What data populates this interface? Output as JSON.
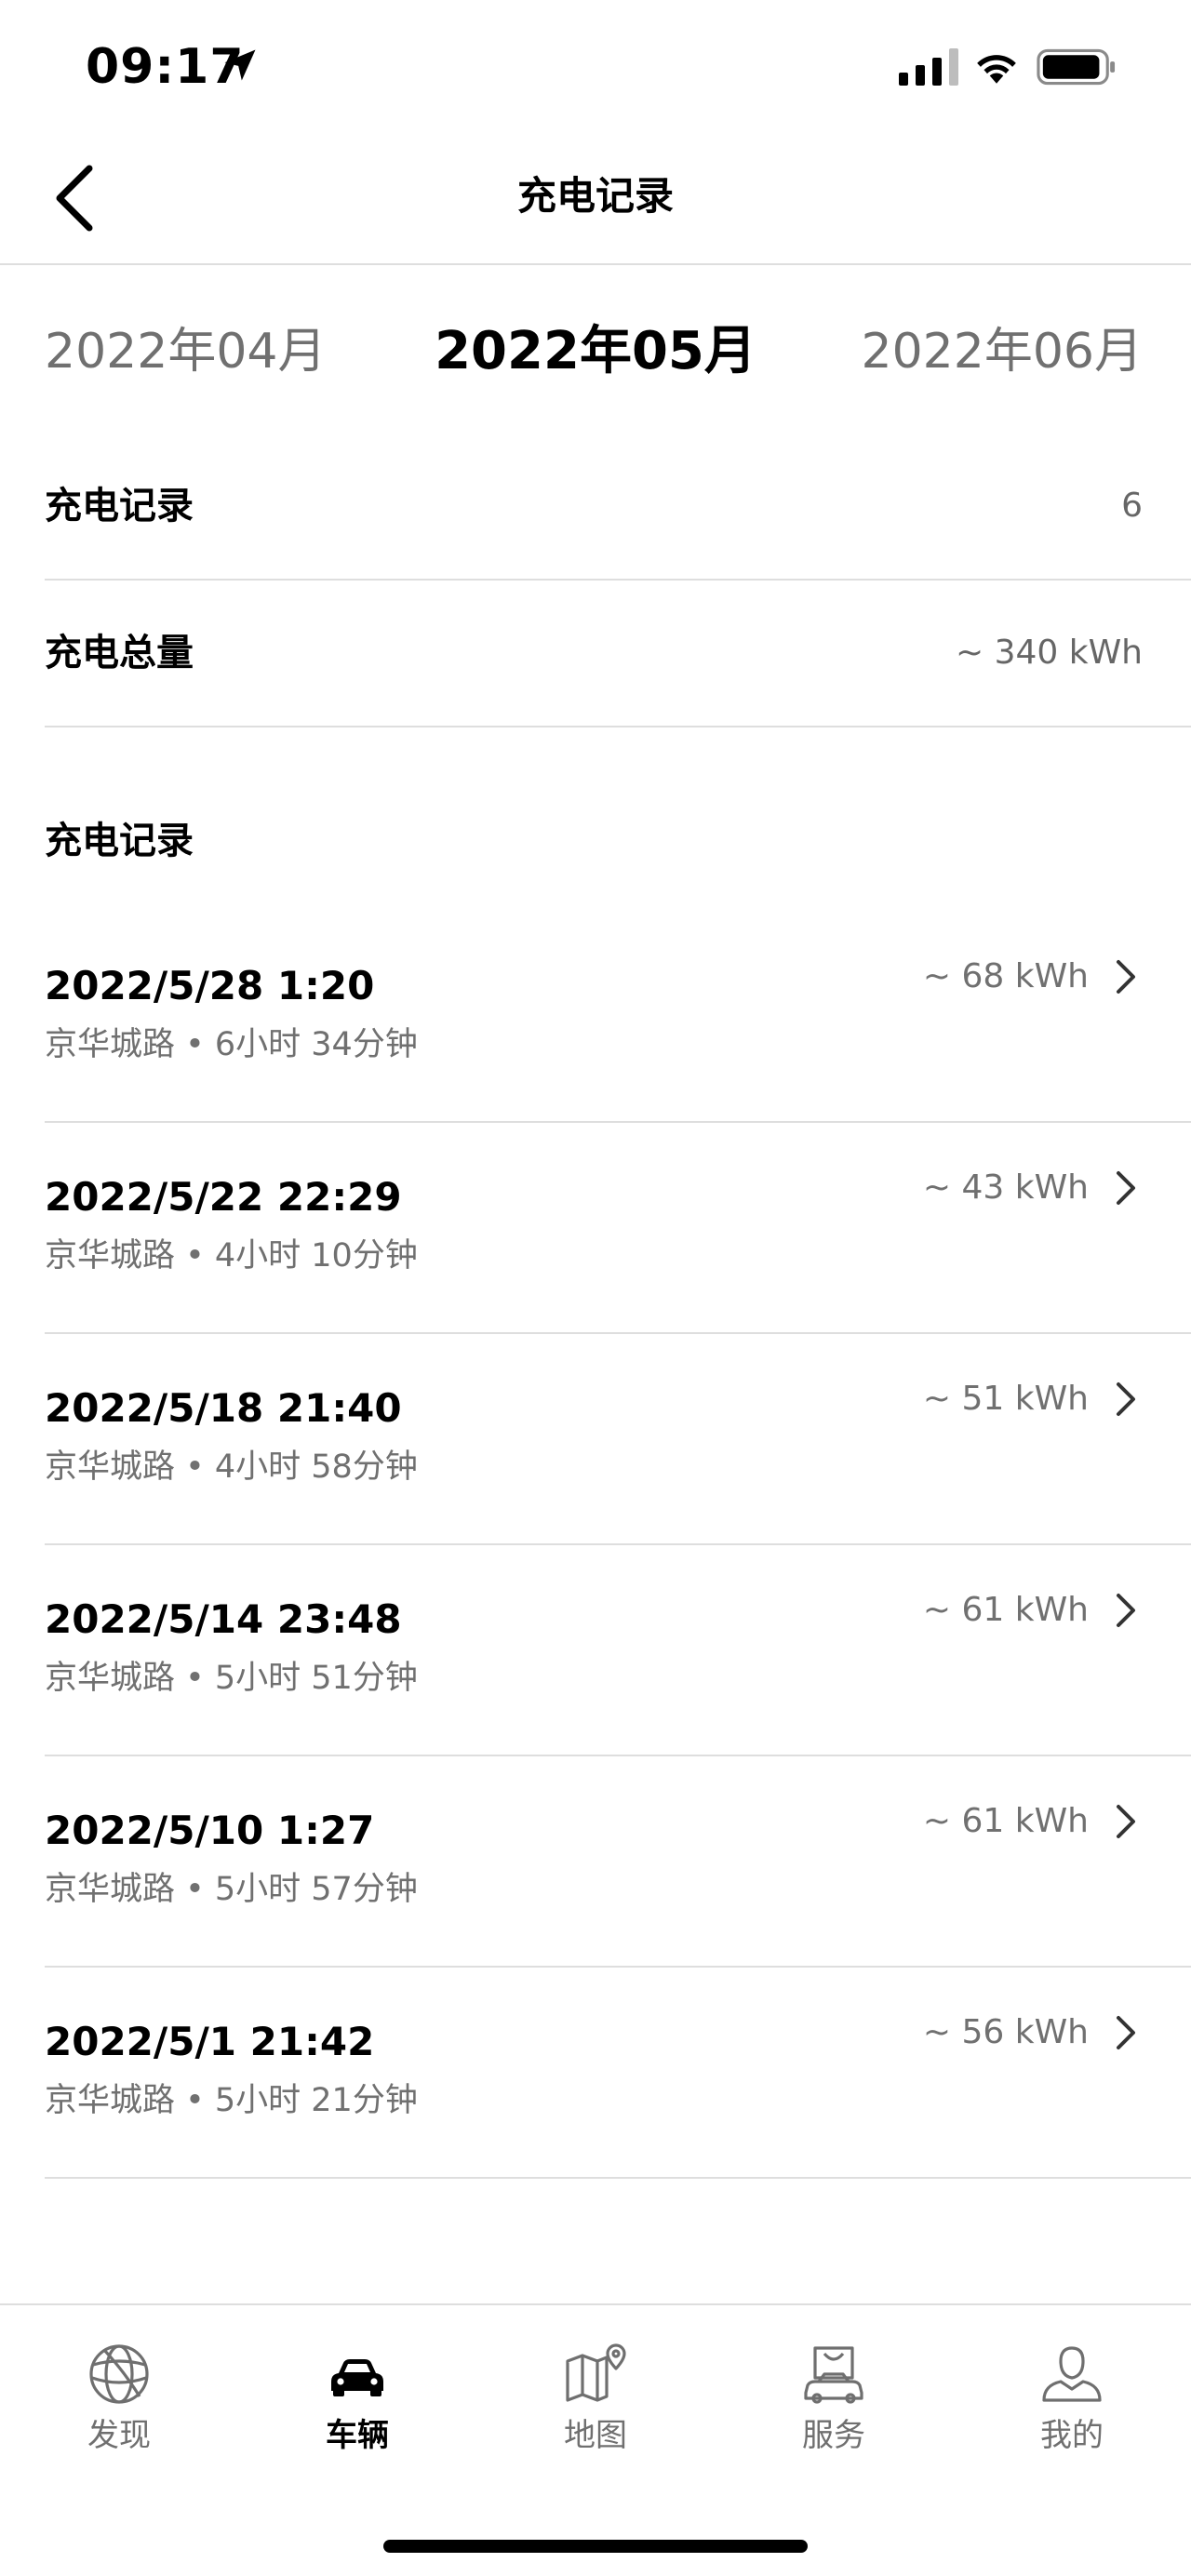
{
  "status_bar": {
    "time": "09:17"
  },
  "nav": {
    "title": "充电记录"
  },
  "months": {
    "prev": "2022年04月",
    "current": "2022年05月",
    "next": "2022年06月"
  },
  "summary": [
    {
      "label": "充电记录",
      "value": "6"
    },
    {
      "label": "充电总量",
      "value": "~ 340 kWh"
    }
  ],
  "section_title": "充电记录",
  "records": [
    {
      "date": "2022/5/28 1:20",
      "meta": "京华城路 • 6小时 34分钟",
      "kwh": "~ 68 kWh"
    },
    {
      "date": "2022/5/22 22:29",
      "meta": "京华城路 • 4小时 10分钟",
      "kwh": "~ 43 kWh"
    },
    {
      "date": "2022/5/18 21:40",
      "meta": "京华城路 • 4小时 58分钟",
      "kwh": "~ 51 kWh"
    },
    {
      "date": "2022/5/14 23:48",
      "meta": "京华城路 • 5小时 51分钟",
      "kwh": "~ 61 kWh"
    },
    {
      "date": "2022/5/10 1:27",
      "meta": "京华城路 • 5小时 57分钟",
      "kwh": "~ 61 kWh"
    },
    {
      "date": "2022/5/1 21:42",
      "meta": "京华城路 • 5小时 21分钟",
      "kwh": "~ 56 kWh"
    }
  ],
  "tabs": [
    {
      "label": "发现",
      "icon": "globe-icon",
      "active": false
    },
    {
      "label": "车辆",
      "icon": "car-icon",
      "active": true
    },
    {
      "label": "地图",
      "icon": "map-icon",
      "active": false
    },
    {
      "label": "服务",
      "icon": "shopping-bag-icon",
      "active": false
    },
    {
      "label": "我的",
      "icon": "person-icon",
      "active": false
    }
  ],
  "colors": {
    "text": "#000000",
    "secondary": "#707070",
    "divider": "#dedede"
  }
}
